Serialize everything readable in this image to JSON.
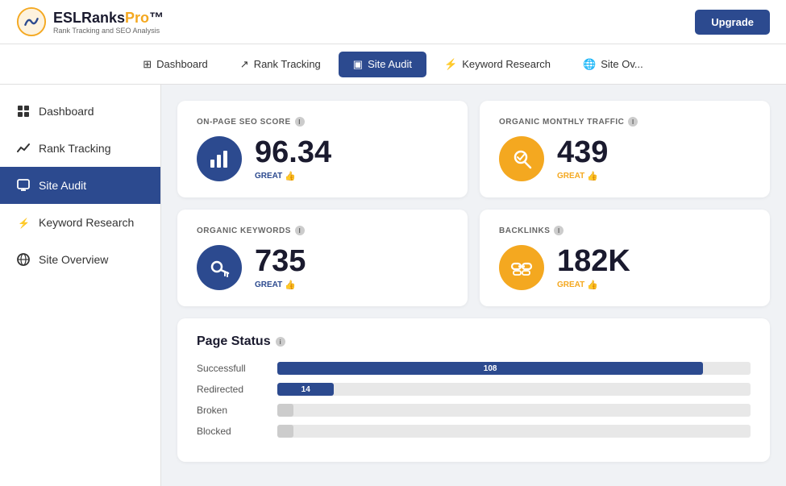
{
  "brand": {
    "name_part1": "ESLRanksPro",
    "name_highlight": "Pro",
    "tagline": "Rank Tracking and SEO Analysis",
    "upgrade_label": "Upgrade"
  },
  "nav": {
    "items": [
      {
        "id": "dashboard",
        "label": "Dashboard",
        "icon": "grid"
      },
      {
        "id": "rank-tracking",
        "label": "Rank Tracking",
        "icon": "trending-up"
      },
      {
        "id": "site-audit",
        "label": "Site Audit",
        "icon": "monitor",
        "active": true
      },
      {
        "id": "keyword-research",
        "label": "Keyword Research",
        "icon": "translate"
      },
      {
        "id": "site-overview",
        "label": "Site Ov...",
        "icon": "globe"
      }
    ]
  },
  "sidebar": {
    "items": [
      {
        "id": "dashboard",
        "label": "Dashboard",
        "icon": "grid"
      },
      {
        "id": "rank-tracking",
        "label": "Rank Tracking",
        "icon": "trending-up"
      },
      {
        "id": "site-audit",
        "label": "Site Audit",
        "icon": "monitor",
        "active": true
      },
      {
        "id": "keyword-research",
        "label": "Keyword Research",
        "icon": "translate"
      },
      {
        "id": "site-overview",
        "label": "Site Overview",
        "icon": "globe"
      }
    ]
  },
  "metrics": {
    "on_page_seo": {
      "title": "ON-PAGE SEO SCORE",
      "value": "96.34",
      "status": "GREAT",
      "icon_type": "blue"
    },
    "organic_traffic": {
      "title": "ORGANIC MONTHLY TRAFFIC",
      "value": "439",
      "status": "GREAT",
      "icon_type": "orange"
    },
    "organic_keywords": {
      "title": "ORGANIC KEYWORDS",
      "value": "735",
      "status": "GREAT",
      "icon_type": "blue"
    },
    "backlinks": {
      "title": "BACKLINKS",
      "value": "182K",
      "status": "GREAT",
      "icon_type": "orange"
    }
  },
  "page_status": {
    "title": "Page Status",
    "rows": [
      {
        "label": "Successfull",
        "value": 108,
        "max": 120,
        "color": "navy"
      },
      {
        "label": "Redirected",
        "value": 14,
        "max": 120,
        "color": "navy"
      },
      {
        "label": "Broken",
        "value": 3,
        "max": 120,
        "color": "navy"
      },
      {
        "label": "Blocked",
        "value": 2,
        "max": 120,
        "color": "navy"
      }
    ]
  },
  "colors": {
    "navy": "#2c4a8f",
    "orange": "#f4a820",
    "great_text_navy": "#2c4a8f",
    "great_text_orange": "#f4a820"
  }
}
